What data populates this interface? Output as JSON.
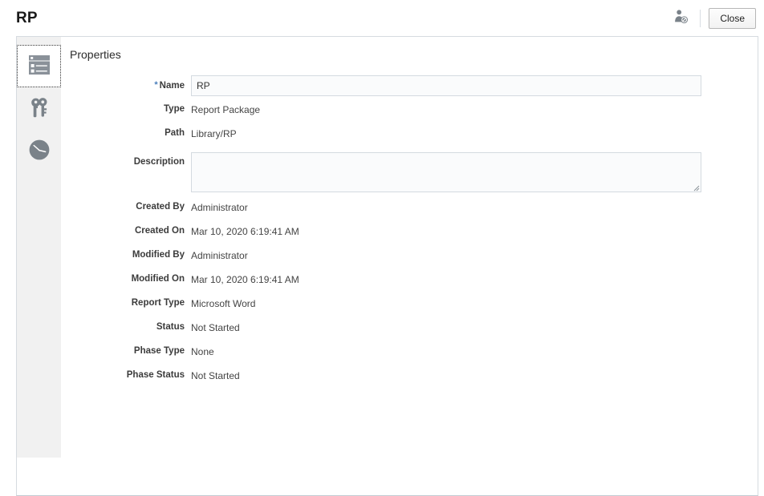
{
  "header": {
    "title": "RP",
    "assign_users_icon": "person-badge-icon",
    "close_label": "Close"
  },
  "sidebar": {
    "items": [
      {
        "icon": "properties-list-icon",
        "name": "properties",
        "selected": true
      },
      {
        "icon": "keys-icon",
        "name": "access",
        "selected": false
      },
      {
        "icon": "clock-icon",
        "name": "history",
        "selected": false
      }
    ]
  },
  "main": {
    "section_title": "Properties",
    "fields": {
      "name": {
        "label": "Name",
        "value": "RP",
        "required_marker": "*"
      },
      "type": {
        "label": "Type",
        "value": "Report Package"
      },
      "path": {
        "label": "Path",
        "value": "Library/RP"
      },
      "description": {
        "label": "Description",
        "value": "",
        "placeholder": ""
      },
      "created_by": {
        "label": "Created By",
        "value": "Administrator"
      },
      "created_on": {
        "label": "Created On",
        "value": "Mar 10, 2020 6:19:41 AM"
      },
      "modified_by": {
        "label": "Modified By",
        "value": "Administrator"
      },
      "modified_on": {
        "label": "Modified On",
        "value": "Mar 10, 2020 6:19:41 AM"
      },
      "report_type": {
        "label": "Report Type",
        "value": "Microsoft Word"
      },
      "status": {
        "label": "Status",
        "value": "Not Started"
      },
      "phase_type": {
        "label": "Phase Type",
        "value": "None"
      },
      "phase_status": {
        "label": "Phase Status",
        "value": "Not Started"
      }
    }
  },
  "colors": {
    "rail_bg": "#f1f1f1",
    "icon_gray": "#7a8289",
    "panel_border": "#d6dbe0",
    "input_bg": "#fafbfc",
    "input_border": "#d4dae0",
    "required_star": "#4a7ebb"
  }
}
